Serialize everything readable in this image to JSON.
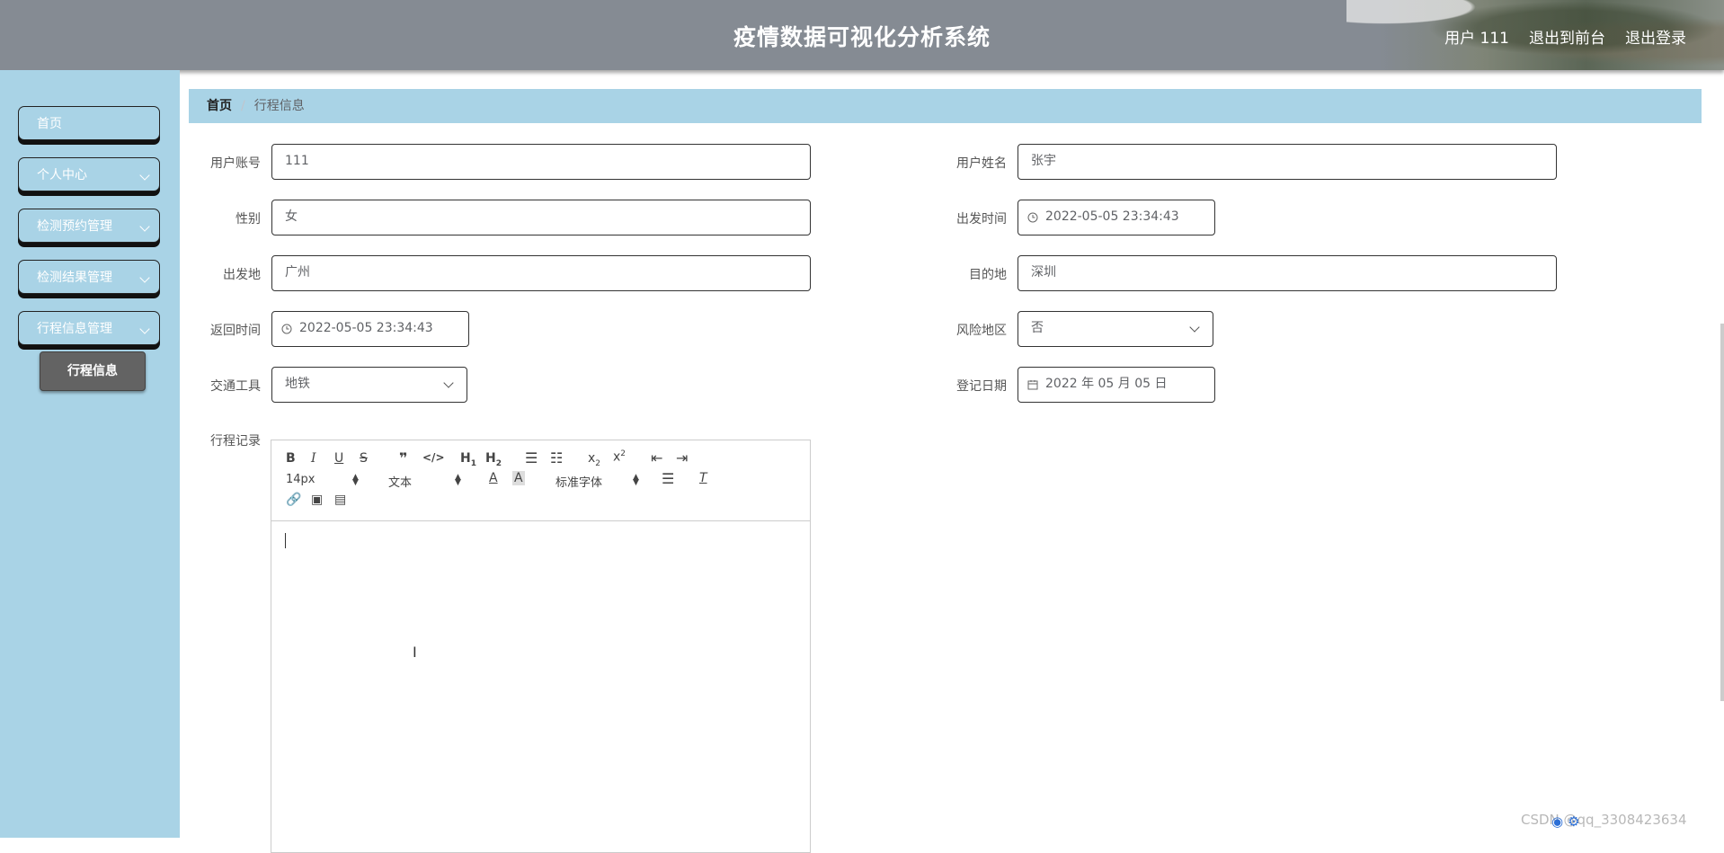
{
  "header": {
    "title": "疫情数据可视化分析系统",
    "user_label": "用户 111",
    "back_to_front": "退出到前台",
    "logout": "退出登录"
  },
  "sidebar": {
    "items": [
      {
        "label": "首页"
      },
      {
        "label": "个人中心"
      },
      {
        "label": "检测预约管理"
      },
      {
        "label": "检测结果管理"
      },
      {
        "label": "行程信息管理"
      }
    ],
    "active_sub": "行程信息"
  },
  "breadcrumb": {
    "home": "首页",
    "current": "行程信息"
  },
  "form": {
    "account": {
      "label": "用户账号",
      "value": "111"
    },
    "name": {
      "label": "用户姓名",
      "value": "张宇"
    },
    "gender": {
      "label": "性别",
      "value": "女"
    },
    "depart_time": {
      "label": "出发时间",
      "value": "2022-05-05 23:34:43"
    },
    "origin": {
      "label": "出发地",
      "value": "广州"
    },
    "destination": {
      "label": "目的地",
      "value": "深圳"
    },
    "return_time": {
      "label": "返回时间",
      "value": "2022-05-05 23:34:43"
    },
    "risk_area": {
      "label": "风险地区",
      "value": "否"
    },
    "transport": {
      "label": "交通工具",
      "value": "地铁"
    },
    "register_date": {
      "label": "登记日期",
      "value": "2022 年 05 月 05 日"
    },
    "record": {
      "label": "行程记录"
    }
  },
  "editor": {
    "font_size": "14px",
    "header_type": "文本",
    "font_family": "标准字体"
  },
  "watermark": "CSDN @qq_3308423634",
  "colors": {
    "sidebar_bg": "#a9d3e6",
    "header_bg": "#858b93",
    "active_sub_bg": "#636363"
  }
}
